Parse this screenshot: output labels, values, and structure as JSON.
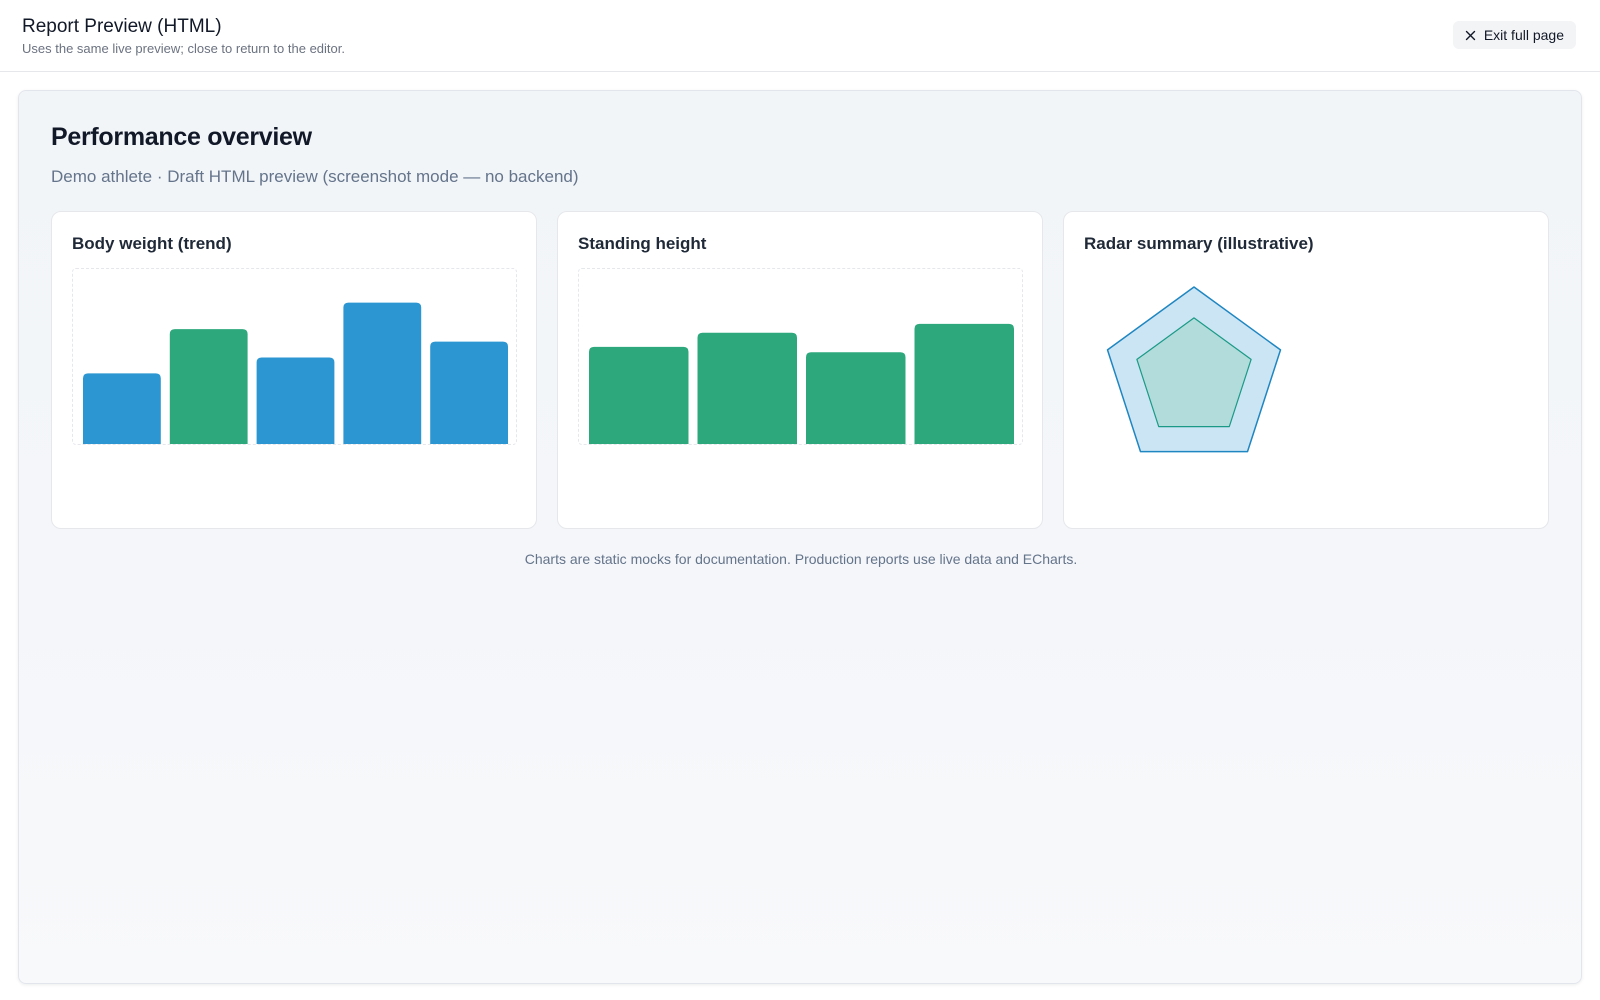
{
  "header": {
    "title": "Report Preview (HTML)",
    "subtitle": "Uses the same live preview; close to return to the editor.",
    "exit_label": "Exit full page",
    "exit_icon": "close-icon"
  },
  "report": {
    "title": "Performance overview",
    "lead": "Demo athlete · Draft HTML preview (screenshot mode — no backend)",
    "footnote": "Charts are static mocks for documentation. Production reports use live data and ECharts."
  },
  "colors": {
    "blue": "#2b96d1",
    "green": "#2da87d",
    "radar_outer_fill": "#cbe5f4",
    "radar_outer_stroke": "#1f86c1",
    "radar_inner_fill": "#b2dcdc",
    "radar_inner_stroke": "#1a9a86"
  },
  "cards": [
    {
      "title": "Body weight (trend)"
    },
    {
      "title": "Standing height"
    },
    {
      "title": "Radar summary (illustrative)"
    }
  ],
  "chart_data": [
    {
      "type": "bar",
      "title": "Body weight (trend)",
      "categories": [
        "",
        "",
        "",
        "",
        ""
      ],
      "values": [
        41,
        66,
        50,
        81,
        59
      ],
      "bar_colors": [
        "blue",
        "green",
        "blue",
        "blue",
        "blue"
      ],
      "ylim": [
        0,
        100
      ]
    },
    {
      "type": "bar",
      "title": "Standing height",
      "categories": [
        "",
        "",
        "",
        ""
      ],
      "values": [
        56,
        64,
        53,
        69
      ],
      "bar_colors": [
        "green",
        "green",
        "green",
        "green"
      ],
      "ylim": [
        0,
        100
      ]
    },
    {
      "type": "radar",
      "title": "Radar summary (illustrative)",
      "axes": 5,
      "series": [
        {
          "values": [
            1,
            1,
            1,
            1,
            1
          ],
          "color": "blue"
        },
        {
          "values": [
            0.66,
            0.66,
            0.66,
            0.66,
            0.66
          ],
          "color": "green"
        }
      ]
    }
  ]
}
